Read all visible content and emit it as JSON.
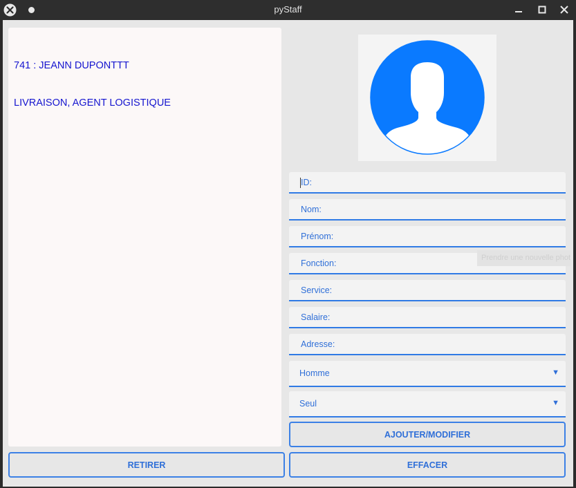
{
  "window": {
    "title": "pyStaff"
  },
  "staff_list": {
    "items": [
      {
        "line1": "741 : JEANN DUPONTTT",
        "line2": "LIVRAISON, AGENT LOGISTIQUE"
      }
    ]
  },
  "form": {
    "fields": [
      {
        "placeholder": "ID:"
      },
      {
        "placeholder": "Nom:"
      },
      {
        "placeholder": "Prénom:"
      },
      {
        "placeholder": "Fonction:"
      },
      {
        "placeholder": "Service:"
      },
      {
        "placeholder": "Salaire:"
      },
      {
        "placeholder": "Adresse:"
      }
    ],
    "gender_select": {
      "value": "Homme"
    },
    "status_select": {
      "value": "Seul"
    },
    "tooltip_text": "Prendre une nouvelle photo"
  },
  "buttons": {
    "add_modify": "AJOUTER/MODIFIER",
    "remove": "RETIRER",
    "clear": "EFFACER"
  },
  "colors": {
    "accent": "#2f7ae5",
    "list_text": "#1515cf",
    "avatar": "#0a7aff"
  }
}
